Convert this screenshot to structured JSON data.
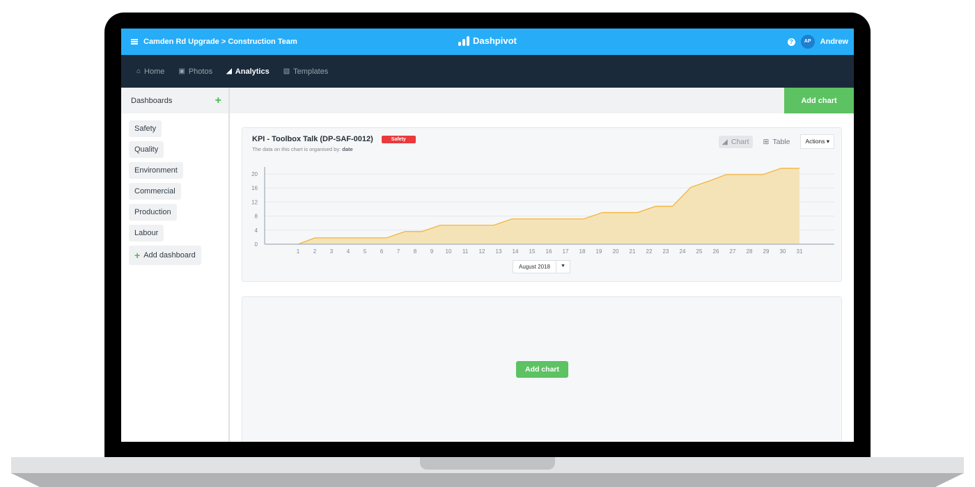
{
  "topbar": {
    "breadcrumb": "Camden Rd Upgrade > Construction Team",
    "brand": "Dashpivot",
    "user_initials": "AP",
    "user_name": "Andrew"
  },
  "nav": {
    "items": [
      {
        "label": "Home",
        "icon": "home-icon",
        "active": false
      },
      {
        "label": "Photos",
        "icon": "camera-icon",
        "active": false
      },
      {
        "label": "Analytics",
        "icon": "area-chart-icon",
        "active": true
      },
      {
        "label": "Templates",
        "icon": "document-icon",
        "active": false
      }
    ]
  },
  "sidebar": {
    "title": "Dashboards",
    "items": [
      "Safety",
      "Quality",
      "Environment",
      "Commercial",
      "Production",
      "Labour"
    ],
    "add_label": "Add dashboard"
  },
  "toolbar": {
    "add_chart_label": "Add chart"
  },
  "card": {
    "title": "KPI - Toolbox Talk (DP-SAF-0012)",
    "badge": "Safety",
    "badge_color": "#ea3a3d",
    "subtitle_prefix": "The data on this chart is organised by:",
    "subtitle_key": "date",
    "view_chart_label": "Chart",
    "view_table_label": "Table",
    "actions_label": "Actions",
    "month_selected": "August 2018"
  },
  "empty_card": {
    "add_chart_label": "Add chart"
  },
  "chart_data": {
    "type": "area",
    "title": "KPI - Toolbox Talk (DP-SAF-0012)",
    "xlabel": "",
    "ylabel": "",
    "x_ticks": [
      "1",
      "2",
      "3",
      "4",
      "5",
      "6",
      "7",
      "8",
      "9",
      "10",
      "11",
      "12",
      "13",
      "14",
      "15",
      "16",
      "17",
      "18",
      "19",
      "20",
      "21",
      "22",
      "23",
      "24",
      "25",
      "26",
      "27",
      "28",
      "29",
      "30",
      "31"
    ],
    "y_ticks": [
      0,
      4,
      8,
      12,
      16,
      20
    ],
    "ylim": [
      0,
      22
    ],
    "xlim": [
      0,
      33
    ],
    "grid": true,
    "line_color": "#f2b53a",
    "fill_color": "#f5e3b8",
    "points": [
      [
        1,
        0
      ],
      [
        2,
        1.8
      ],
      [
        6.3,
        1.8
      ],
      [
        7.4,
        3.6
      ],
      [
        8.4,
        3.6
      ],
      [
        9.5,
        5.4
      ],
      [
        12.7,
        5.4
      ],
      [
        13.8,
        7.2
      ],
      [
        18.1,
        7.2
      ],
      [
        19.2,
        9.0
      ],
      [
        21.3,
        9.0
      ],
      [
        22.4,
        10.8
      ],
      [
        23.4,
        10.8
      ],
      [
        24.5,
        16.2
      ],
      [
        25.6,
        18.0
      ],
      [
        26.6,
        19.8
      ],
      [
        28.8,
        19.8
      ],
      [
        29.9,
        21.6
      ],
      [
        31,
        21.6
      ]
    ]
  }
}
